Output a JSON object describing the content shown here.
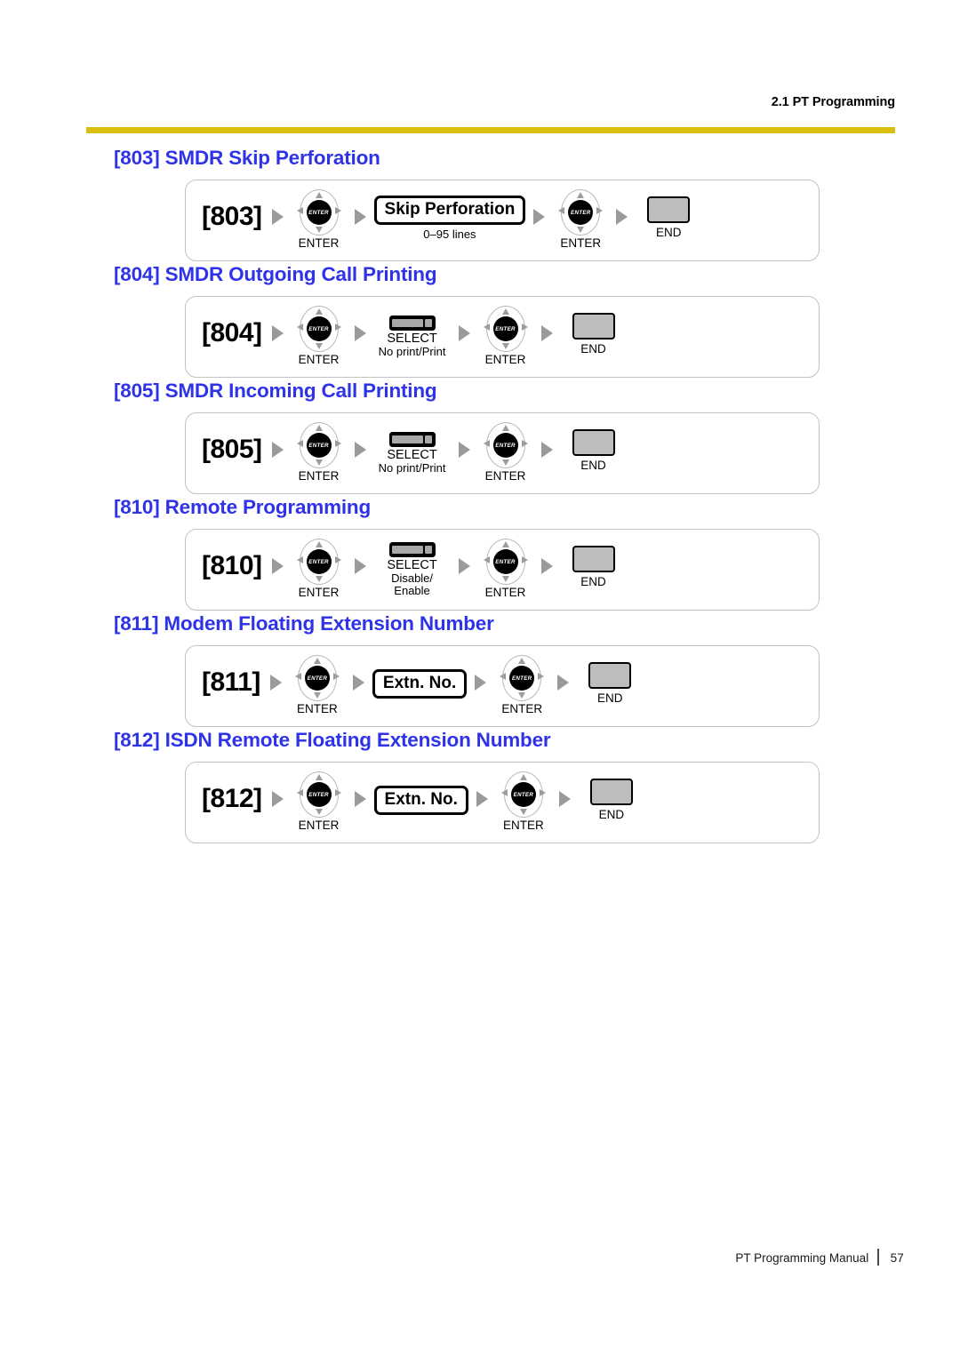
{
  "header": {
    "title": "2.1 PT Programming",
    "rule_color": "#d9bf0d"
  },
  "theme": {
    "heading_color": "#2f33e8",
    "key_gray": "#bdbdbd",
    "arrow_gray": "#9a9a9a"
  },
  "sections": [
    {
      "heading": "[803] SMDR Skip Perforation",
      "code": "[803]",
      "enter1_label": "ENTER",
      "enter1_hub": "ENTER",
      "middle": {
        "kind": "entry",
        "box_label": "Skip Perforation",
        "sub_label": "0–95 lines"
      },
      "enter2_label": "ENTER",
      "enter2_hub": "ENTER",
      "end_label": "END"
    },
    {
      "heading": "[804] SMDR Outgoing Call Printing",
      "code": "[804]",
      "enter1_label": "ENTER",
      "enter1_hub": "ENTER",
      "middle": {
        "kind": "select",
        "key_label": "SELECT",
        "sub_label": "No print/Print"
      },
      "enter2_label": "ENTER",
      "enter2_hub": "ENTER",
      "end_label": "END"
    },
    {
      "heading": "[805] SMDR Incoming Call Printing",
      "code": "[805]",
      "enter1_label": "ENTER",
      "enter1_hub": "ENTER",
      "middle": {
        "kind": "select",
        "key_label": "SELECT",
        "sub_label": "No print/Print"
      },
      "enter2_label": "ENTER",
      "enter2_hub": "ENTER",
      "end_label": "END"
    },
    {
      "heading": "[810] Remote Programming",
      "code": "[810]",
      "enter1_label": "ENTER",
      "enter1_hub": "ENTER",
      "middle": {
        "kind": "select",
        "key_label": "SELECT",
        "sub_label": "Disable/ Enable",
        "sub_line1": "Disable/",
        "sub_line2": "Enable"
      },
      "enter2_label": "ENTER",
      "enter2_hub": "ENTER",
      "end_label": "END"
    },
    {
      "heading": "[811] Modem Floating Extension Number",
      "code": "[811]",
      "enter1_label": "ENTER",
      "enter1_hub": "ENTER",
      "middle": {
        "kind": "entry",
        "box_label": "Extn. No.",
        "sub_label": ""
      },
      "enter2_label": "ENTER",
      "enter2_hub": "ENTER",
      "end_label": "END"
    },
    {
      "heading": "[812] ISDN Remote Floating Extension Number",
      "code": "[812]",
      "enter1_label": "ENTER",
      "enter1_hub": "ENTER",
      "middle": {
        "kind": "entry",
        "box_label": "Extn. No.",
        "sub_label": ""
      },
      "enter2_label": "ENTER",
      "enter2_hub": "ENTER",
      "end_label": "END"
    }
  ],
  "footer": {
    "manual_title": "PT Programming Manual",
    "page_number": "57"
  }
}
